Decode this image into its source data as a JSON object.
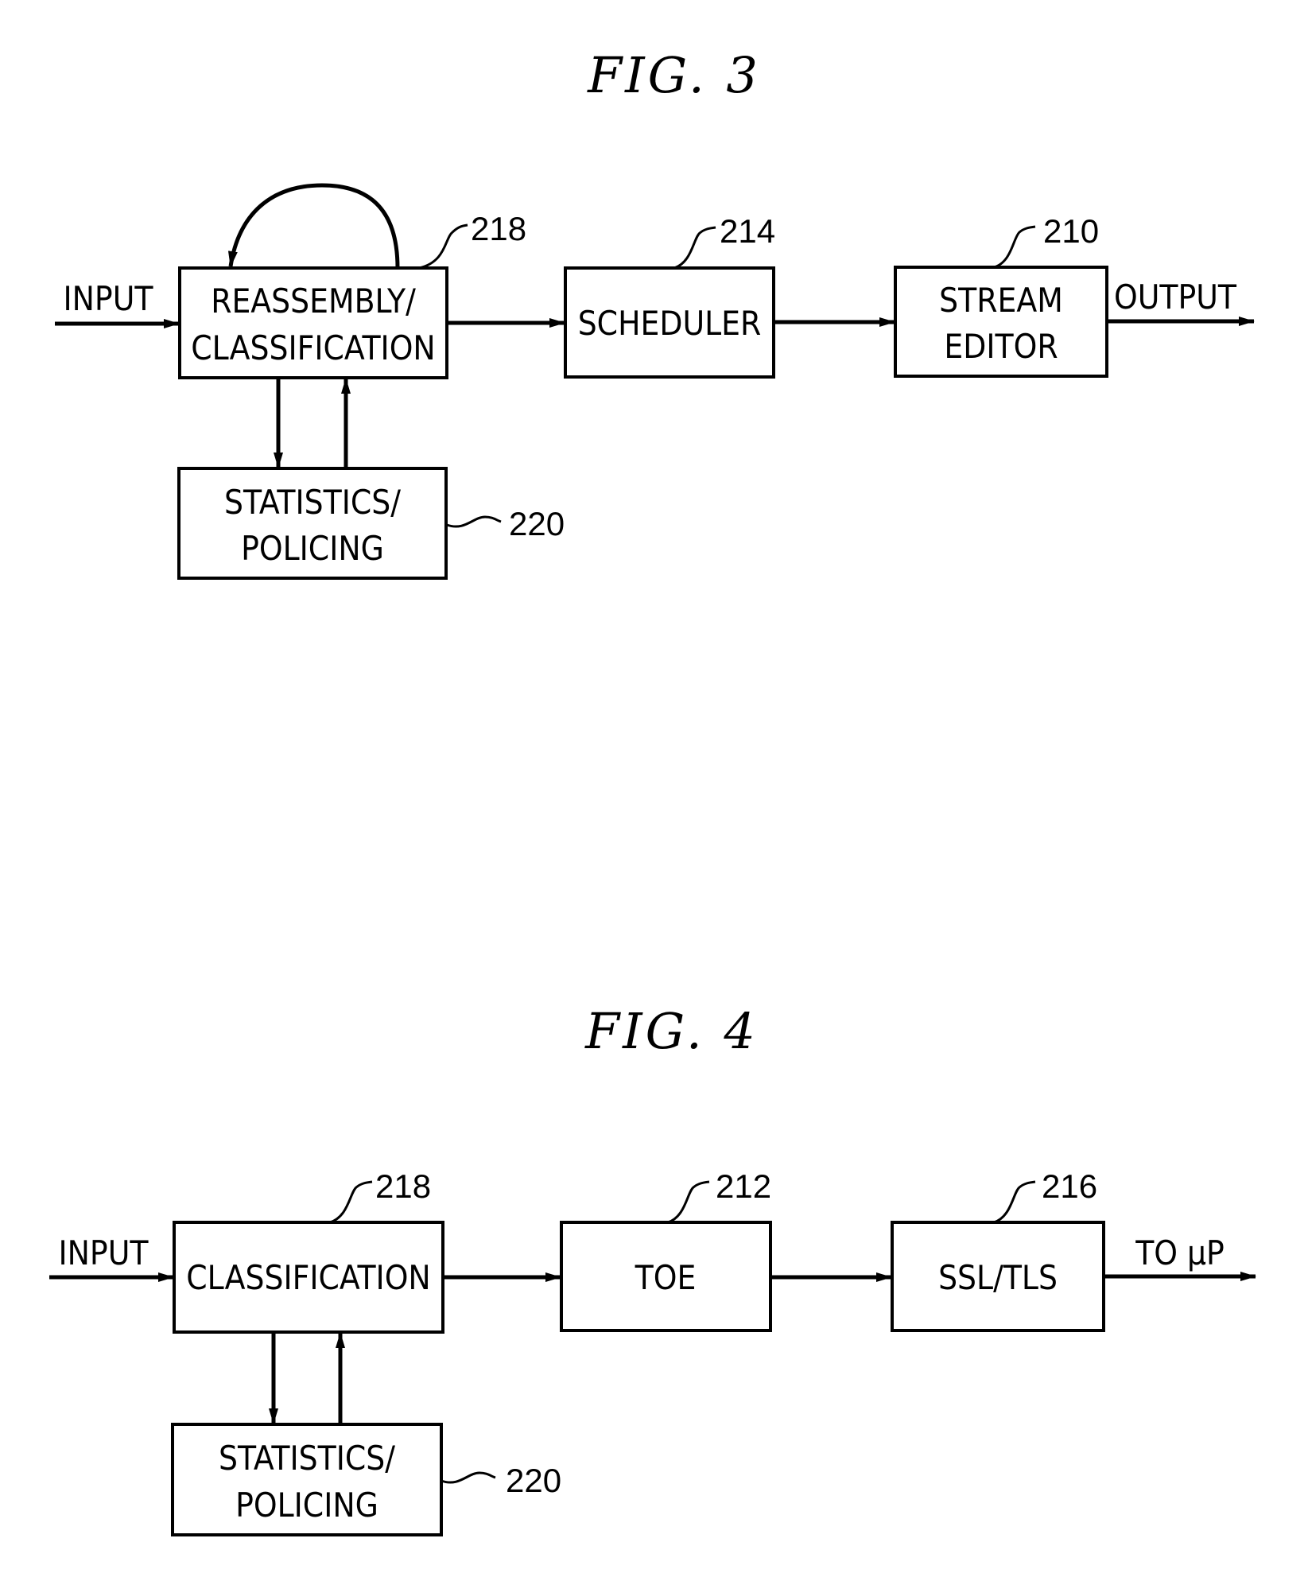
{
  "figures": [
    {
      "title": "FIG. 3",
      "input_label": "INPUT",
      "output_label": "OUTPUT",
      "blocks": [
        {
          "ref": "218",
          "lines": [
            "REASSEMBLY/",
            "CLASSIFICATION"
          ]
        },
        {
          "ref": "214",
          "lines": [
            "SCHEDULER"
          ]
        },
        {
          "ref": "210",
          "lines": [
            "STREAM",
            "EDITOR"
          ]
        },
        {
          "ref": "220",
          "lines": [
            "STATISTICS/",
            "POLICING"
          ]
        }
      ]
    },
    {
      "title": "FIG. 4",
      "input_label": "INPUT",
      "output_label": "TO μP",
      "blocks": [
        {
          "ref": "218",
          "lines": [
            "CLASSIFICATION"
          ]
        },
        {
          "ref": "212",
          "lines": [
            "TOE"
          ]
        },
        {
          "ref": "216",
          "lines": [
            "SSL/TLS"
          ]
        },
        {
          "ref": "220",
          "lines": [
            "STATISTICS/",
            "POLICING"
          ]
        }
      ]
    }
  ]
}
